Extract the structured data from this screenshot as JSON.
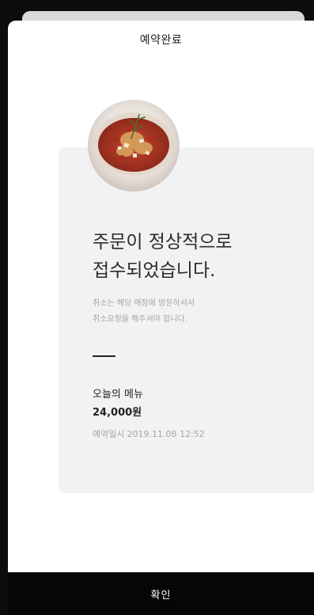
{
  "header": {
    "title": "예약완료"
  },
  "main": {
    "headline_line1": "주문이 정상적으로",
    "headline_line2": "접수되었습니다.",
    "notice_line1": "취소는 해당 매장에 방문하셔서",
    "notice_line2": "취소요청을 해주셔야 합니다.",
    "menu_name": "오늘의 메뉴",
    "price": "24,000원",
    "date_label": "예약일시",
    "date_value": "2019.11.08 12:52"
  },
  "footer": {
    "confirm_label": "확인"
  }
}
